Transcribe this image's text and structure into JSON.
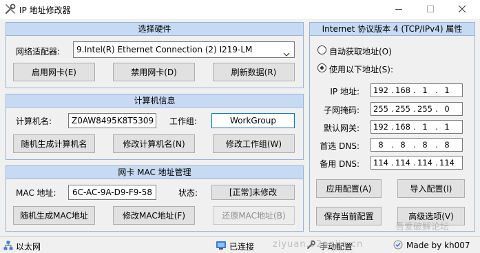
{
  "window": {
    "title": "IP 地址修改器",
    "icon": "tools-icon",
    "controls": [
      "minimize-icon",
      "maximize-icon",
      "close-icon"
    ]
  },
  "hardware": {
    "header": "选择硬件",
    "adapter_label": "网络适配器:",
    "adapter_value": "9.Intel(R) Ethernet Connection (2) I219-LM",
    "enable_button": "启用网卡(E)",
    "disable_button": "禁用网卡(D)",
    "refresh_button": "刷新数据(R)"
  },
  "computer": {
    "header": "计算机信息",
    "name_label": "计算机名:",
    "name_value": "Z0AW8495K8T5309",
    "workgroup_label": "工作组:",
    "workgroup_value": "WorkGroup",
    "random_name_button": "随机生成计算机名",
    "modify_name_button": "修改计算机名(N)",
    "modify_workgroup_button": "修改工作组(W)"
  },
  "mac": {
    "header": "网卡 MAC 地址管理",
    "mac_label": "MAC 地址:",
    "mac_value": "6C-AC-9A-D9-F9-58",
    "status_label": "状态:",
    "status_value": "[正常]未修改",
    "random_mac_button": "随机生成MAC地址",
    "modify_mac_button": "修改MAC地址(F)",
    "restore_mac_button": "还原MAC地址(B)"
  },
  "ipv4": {
    "header": "Internet 协议版本 4 (TCP/IPv4) 属性",
    "auto_radio": "自动获取地址(O)",
    "manual_radio": "使用以下地址(S):",
    "rows": [
      {
        "label": "IP 地址:",
        "octets": [
          "192",
          "168",
          "1",
          "1"
        ]
      },
      {
        "label": "子网掩码:",
        "octets": [
          "255",
          "255",
          "255",
          "0"
        ]
      },
      {
        "label": "默认网关:",
        "octets": [
          "192",
          "168",
          "1",
          "1"
        ]
      },
      {
        "label": "首选 DNS:",
        "octets": [
          "8",
          "8",
          "8",
          "8"
        ]
      },
      {
        "label": "备用 DNS:",
        "octets": [
          "114",
          "114",
          "114",
          "114"
        ]
      }
    ],
    "apply_button": "应用配置(A)",
    "import_button": "导入配置(I)",
    "save_button": "保存当前配置",
    "advanced_button": "高级选项(V)"
  },
  "statusbar": {
    "network_name": "以太网",
    "connection": "已连接",
    "mode": "手动配置",
    "credit": "Made by kh007"
  },
  "watermark": {
    "line1": "吾爱破解论坛",
    "line2": "ziyuan.52pojie.cn"
  },
  "colors": {
    "panel_header": "#c6dbf3",
    "panel_border": "#98b4d4",
    "focus": "#0078d7"
  }
}
